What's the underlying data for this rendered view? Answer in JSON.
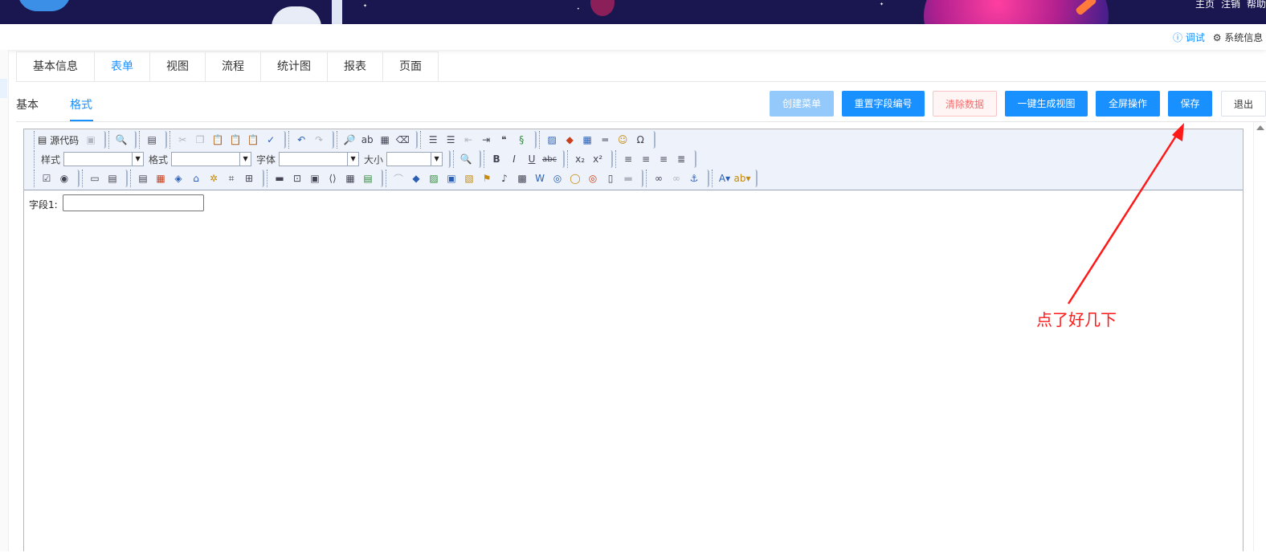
{
  "header": {
    "links": [
      "主页",
      "注销",
      "帮助"
    ],
    "debug_label": "调试",
    "sysinfo_label": "系统信息"
  },
  "tabs": [
    "基本信息",
    "表单",
    "视图",
    "流程",
    "统计图",
    "报表",
    "页面"
  ],
  "active_tab": "表单",
  "subtabs": {
    "base": "基本",
    "format": "格式"
  },
  "actions": {
    "create_menu": "创建菜单",
    "reset_field_no": "重置字段编号",
    "clear_data": "清除数据",
    "generate_view": "一键生成视图",
    "fullscreen": "全屏操作",
    "save": "保存",
    "exit": "退出"
  },
  "toolbar": {
    "source_label": "源代码",
    "style_label": "样式",
    "format_label": "格式",
    "font_label": "字体",
    "size_label": "大小",
    "bold": "B",
    "italic": "I",
    "underline": "U",
    "strike": "abc"
  },
  "content": {
    "field_label": "字段1:",
    "field_value": ""
  },
  "annotation": "点了好几下",
  "colors": {
    "primary": "#1890ff",
    "annotation": "#ff1a1a",
    "banner": "#1a1750"
  }
}
